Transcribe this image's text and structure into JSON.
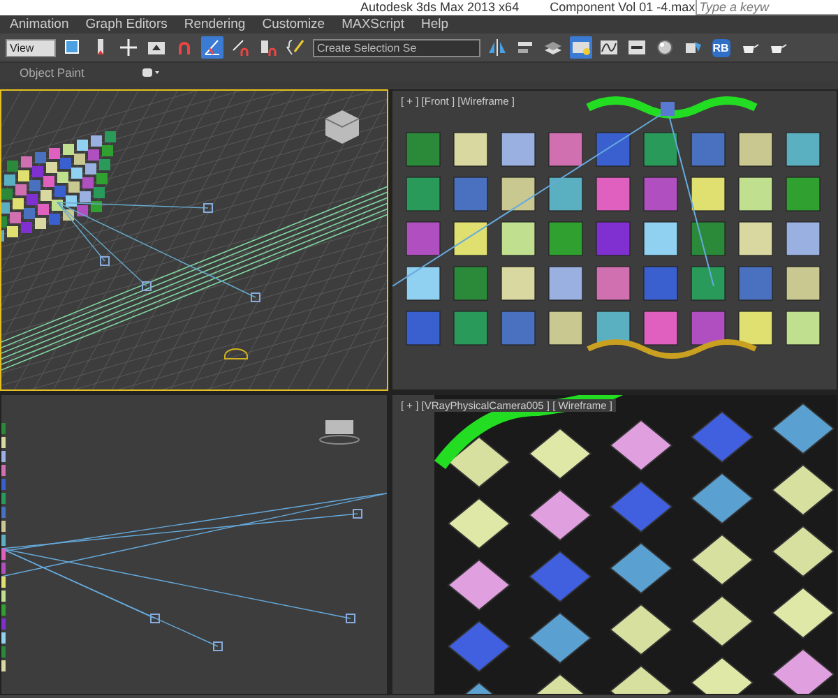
{
  "title_bar": {
    "app_title": "Autodesk 3ds Max  2013 x64",
    "document_title": "Component Vol 01 -4.max",
    "search_placeholder": "Type a keyw"
  },
  "menu": [
    "Animation",
    "Graph Editors",
    "Rendering",
    "Customize",
    "MAXScript",
    "Help"
  ],
  "toolbar": {
    "view_dropdown": "View",
    "selection_set": "Create Selection Se",
    "buttons": [
      {
        "kind": "select-region",
        "on": false
      },
      {
        "kind": "pivot",
        "on": false
      },
      {
        "kind": "move",
        "on": false
      },
      {
        "kind": "window",
        "on": false
      },
      {
        "kind": "snap",
        "on": false
      },
      {
        "kind": "angle-snap",
        "on": true
      },
      {
        "kind": "percent-snap",
        "on": false
      },
      {
        "kind": "spinner-snap",
        "on": false
      },
      {
        "kind": "named-sets",
        "on": false
      },
      {
        "kind": "mirror",
        "on": false
      },
      {
        "kind": "align",
        "on": false
      },
      {
        "kind": "layers",
        "on": false
      },
      {
        "kind": "explorer",
        "on": true
      },
      {
        "kind": "curve",
        "on": false
      },
      {
        "kind": "schematic",
        "on": false
      },
      {
        "kind": "material",
        "on": false
      },
      {
        "kind": "render-setup",
        "on": false
      },
      {
        "kind": "rb",
        "on": false,
        "label": "RB"
      },
      {
        "kind": "teapot",
        "on": false
      },
      {
        "kind": "teapot",
        "on": false
      }
    ]
  },
  "ribbon": {
    "label": "Object Paint"
  },
  "viewports": [
    {
      "kind": "perspective",
      "selected": true
    },
    {
      "kind": "front",
      "selected": false,
      "label": "[ + ] [Front ] [Wireframe ]"
    },
    {
      "kind": "left",
      "selected": false
    },
    {
      "kind": "camera",
      "selected": false,
      "label": "[ + ] [VRayPhysicalCamera005 ] [ Wireframe ]"
    }
  ]
}
